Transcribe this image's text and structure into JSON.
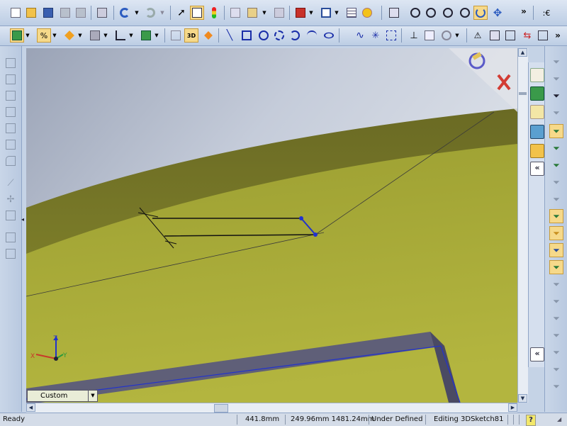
{
  "status": {
    "ready": "Ready",
    "length": "441.8mm",
    "coordinates": "249.96mm 1481.24mm",
    "state": "Under Defined",
    "editing": "Editing 3DSketch81",
    "help": "?"
  },
  "view": {
    "orientation_dropdown": "Custom",
    "triad_x": "X",
    "triad_y": "Y",
    "triad_z": "Z"
  },
  "toolbar": {
    "more_chevron": "»",
    "more_chevron2": "»"
  },
  "taskpane": {
    "collapse": "«",
    "collapse2": "«"
  },
  "colors": {
    "surface": "#a6a935",
    "sky": "#c5ccda",
    "selection": "#2233cc"
  }
}
